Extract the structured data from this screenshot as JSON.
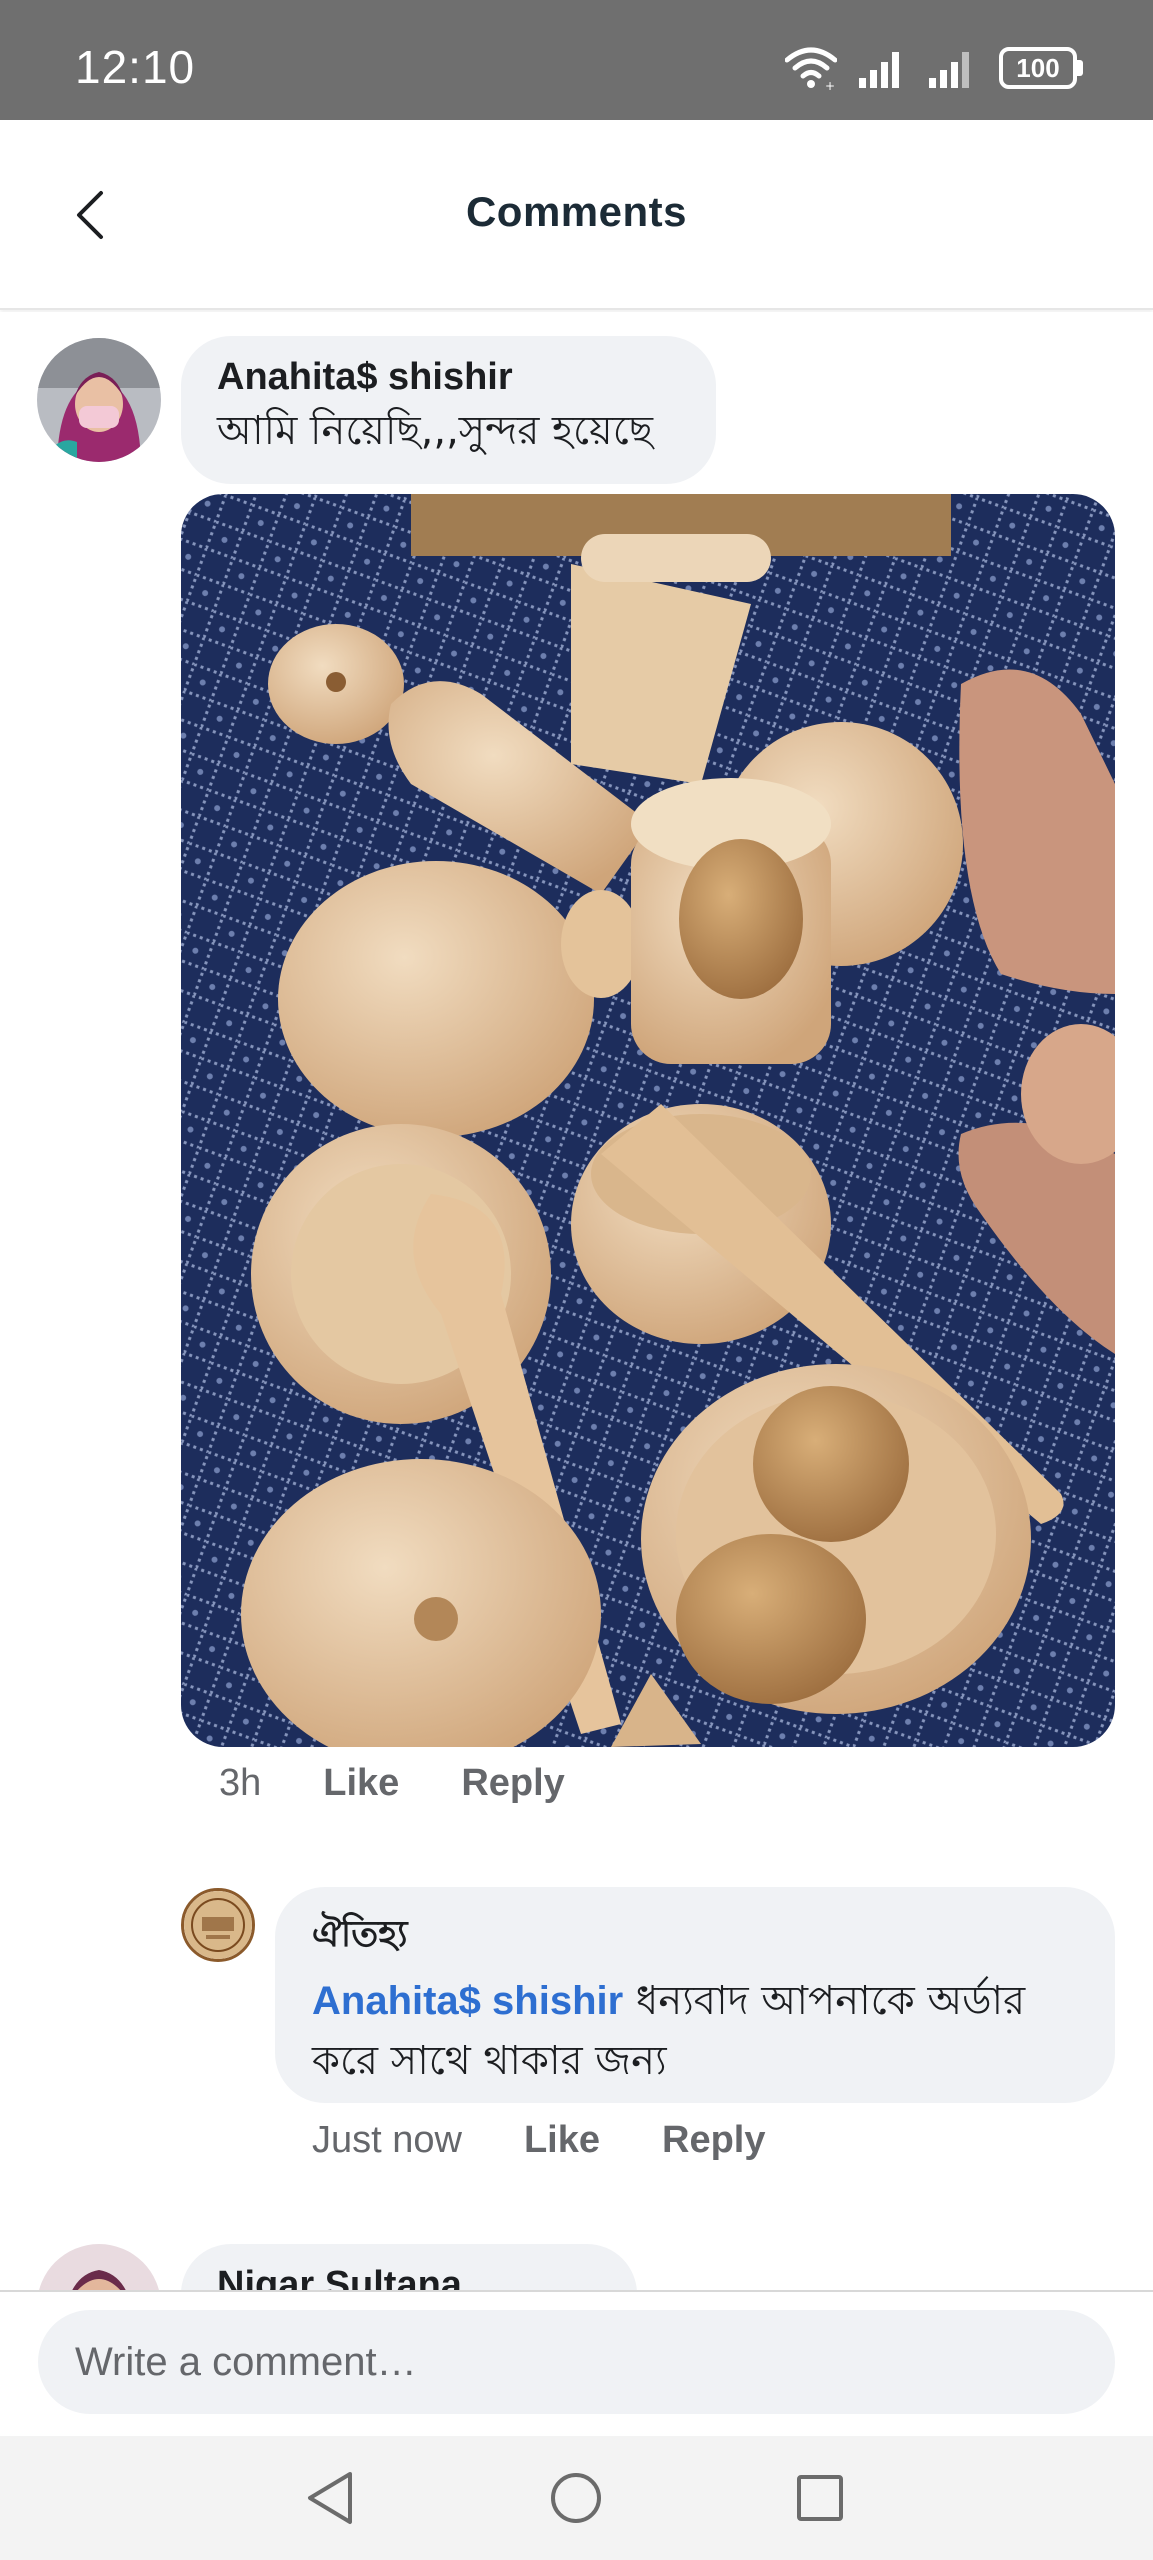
{
  "status_bar": {
    "time": "12:10",
    "battery": "100",
    "icons": [
      "wifi-icon",
      "signal-icon",
      "signal-icon",
      "battery-icon"
    ]
  },
  "header": {
    "title": "Comments",
    "back_icon": "chevron-left-icon"
  },
  "comments": [
    {
      "author": "Anahita$ shishir",
      "text": "আমি নিয়েছি,,,সুন্দর হয়েছে",
      "has_photo": true,
      "time": "3h",
      "like_label": "Like",
      "reply_label": "Reply"
    },
    {
      "author": "ঐতিহ্য",
      "mention": "Anahita$ shishir",
      "text_line1": " ধন্যবাদ আপনাকে অর্ডার",
      "text_line2": "করে সাথে থাকার জন্য",
      "time": "Just now",
      "like_label": "Like",
      "reply_label": "Reply"
    },
    {
      "author": "Nigar Sultana Sultana"
    }
  ],
  "composer": {
    "placeholder": "Write a comment…"
  },
  "nav_bar": {
    "icons": [
      "back-triangle-icon",
      "home-circle-icon",
      "recents-square-icon"
    ]
  },
  "colors": {
    "status_bar": "#6f6f6f",
    "bubble": "#f0f2f5",
    "mention": "#2e6fd1",
    "meta": "#65676b",
    "photo_background": "#1c2c5a"
  }
}
